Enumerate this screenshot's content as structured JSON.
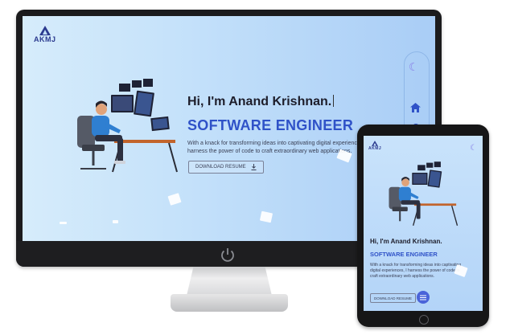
{
  "brand": {
    "logo_text": "AKMJ"
  },
  "hero": {
    "greeting": "Hi, I'm Anand Krishnan.",
    "role": "SOFTWARE ENGINEER",
    "description": "With a knack for transforming ideas into captivating digital experiences, I harness the power of code to craft extraordinary web applications.",
    "resume_button": "DOWNLOAD RESUME"
  },
  "tablet": {
    "greeting": "Hi, I'm Anand Krishnan.",
    "role": "SOFTWARE ENGINEER",
    "description": "With a knack for transforming ideas into captivating digital experiences, I harness the power of code to craft extraordinary web applications.",
    "resume_button": "DOWNLOAD RESUME"
  },
  "icons": {
    "theme_toggle": "moon-icon",
    "nav_home": "home-icon",
    "download": "download-icon",
    "menu": "menu-icon",
    "power": "power-icon"
  },
  "colors": {
    "accent": "#2f52c8",
    "brand": "#2b3a8f",
    "moon": "#8a82e8",
    "bg_light": "#d6ecfb",
    "bg_dark": "#a9cdf6"
  }
}
